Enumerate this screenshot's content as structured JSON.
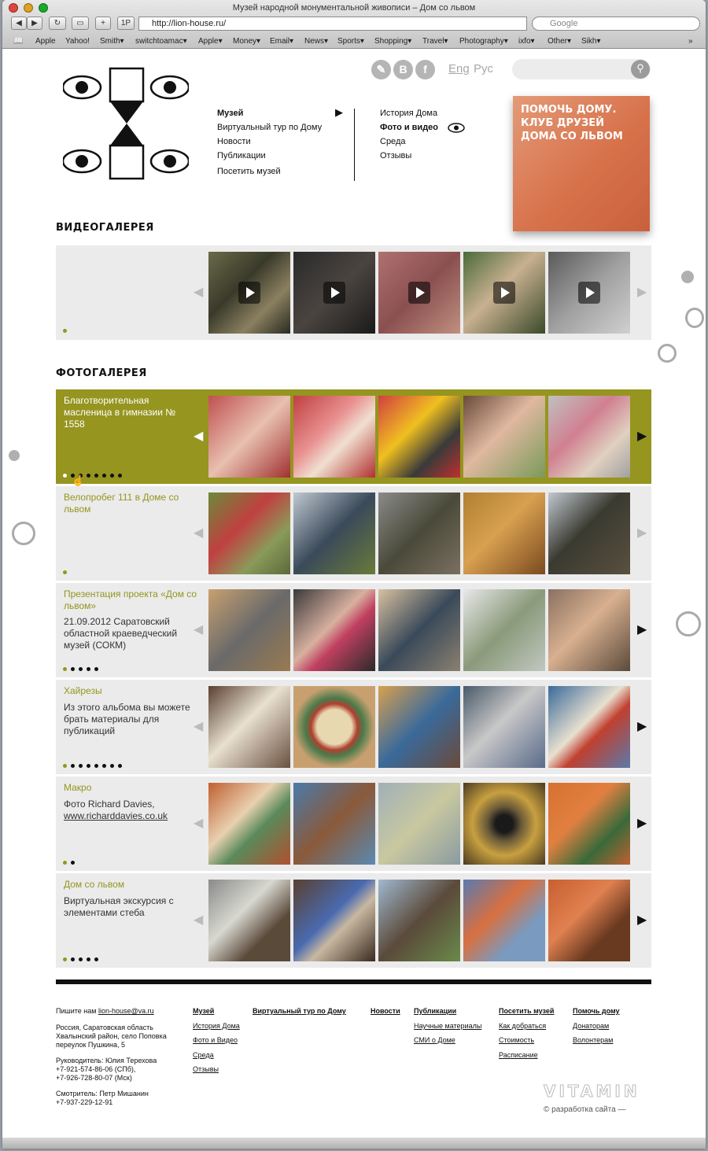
{
  "window": {
    "title": "Музей народной монументальной живописи – Дом со львом"
  },
  "toolbar": {
    "url": "http://lion-house.ru/",
    "search_placeholder": "Google",
    "reader_label": "1P"
  },
  "bookmarks": [
    "Apple",
    "Yahoo!",
    "Smith▾",
    "switchtoamac▾",
    "Apple▾",
    "Money▾",
    "Email▾",
    "News▾",
    "Sports▾",
    "Shopping▾",
    "Travel▾",
    "Photography▾",
    "ixfo▾",
    "Other▾",
    "Sikh▾"
  ],
  "header": {
    "nav_main": [
      "Музей",
      "Виртуальный тур по Дому",
      "Новости",
      "Публикации",
      "Посетить музей"
    ],
    "nav_sub": [
      "История Дома",
      "Фото и видео",
      "Среда",
      "Отзывы"
    ],
    "social": [
      "✎",
      "B",
      "f"
    ],
    "lang_eng": "Eng",
    "lang_rus": "Рус",
    "help_banner": "ПОМОЧЬ ДОМУ. КЛУБ ДРУЗЕЙ ДОМА СО ЛЬВОМ"
  },
  "video": {
    "title": "ВИДЕОГАЛЕРЕЯ"
  },
  "photo": {
    "title": "ФОТОГАЛЕРЕЯ",
    "albums": [
      {
        "title": "Благотворительная масленица в гимназии № 1558",
        "desc": ""
      },
      {
        "title": "Велопробег 111 в Доме со львом",
        "desc": ""
      },
      {
        "title": "Презентация проекта «Дом со львом»",
        "desc": "21.09.2012 Саратовский областной краеведческий музей (СОКМ)"
      },
      {
        "title": "Хайрезы",
        "desc": "Из этого альбома вы можете брать материалы для публикаций"
      },
      {
        "title": "Макро",
        "desc": "Фото Richard Davies,",
        "link": "www.richarddavies.co.uk"
      },
      {
        "title": "Дом со львом",
        "desc": "Виртуальная экскурсия с элементами стеба"
      }
    ]
  },
  "footer": {
    "contact_prefix": "Пишите нам",
    "email": "lion-house@va.ru",
    "address": [
      "Россия, Саратовская область",
      "Хвалынский район, село Поповка",
      "переулок Пушкина, 5"
    ],
    "manager": [
      "Руководитель: Юлия Терехова",
      "+7-921-574-86-06 (СПб),",
      "+7-926-728-80-07 (Мск)"
    ],
    "keeper": [
      "Смотритель: Петр Мишанин",
      "+7-937-229-12-91"
    ],
    "col_museum": [
      "Музей",
      "История Дома",
      "Фото и Видео",
      "Среда",
      "Отзывы"
    ],
    "col_tour": [
      "Виртуальный тур по Дому"
    ],
    "col_news": [
      "Новости"
    ],
    "col_pubs": [
      "Публикации",
      "Научные материалы",
      "СМИ о Доме"
    ],
    "col_visit": [
      "Посетить музей",
      "Как добраться",
      "Стоимость",
      "Расписание"
    ],
    "col_help": [
      "Помочь дому",
      "Донаторам",
      "Волонтерам"
    ],
    "brand": "VITAMIN",
    "credit": "© разработка сайта —"
  },
  "colors": {
    "accent": "#959520",
    "row_bg": "#ebebeb"
  }
}
